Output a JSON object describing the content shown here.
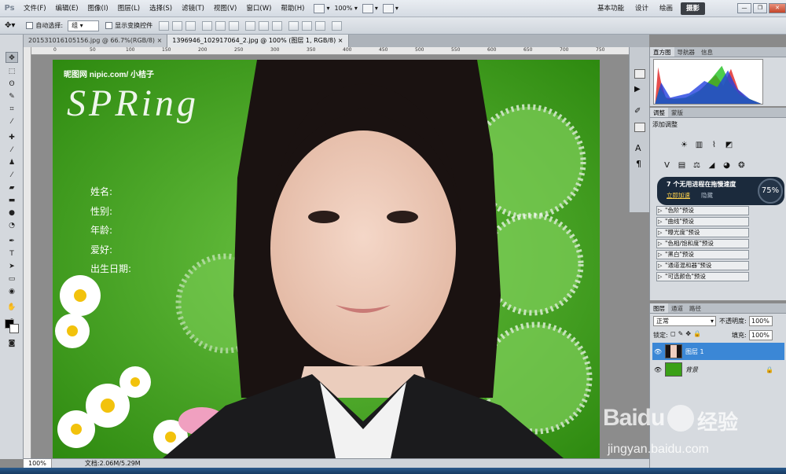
{
  "app": {
    "logo": "Ps"
  },
  "menu": [
    "文件(F)",
    "编辑(E)",
    "图像(I)",
    "图层(L)",
    "选择(S)",
    "滤镜(T)",
    "视图(V)",
    "窗口(W)",
    "帮助(H)"
  ],
  "menubar_zoom": "100%",
  "workspaces": [
    {
      "label": "基本功能",
      "active": false
    },
    {
      "label": "设计",
      "active": false
    },
    {
      "label": "绘画",
      "active": false
    },
    {
      "label": "摄影",
      "active": true
    }
  ],
  "window_buttons": {
    "minimize": "—",
    "restore": "❐",
    "close": "✕"
  },
  "options": {
    "auto_select_label": "自动选择:",
    "auto_select_value": "组",
    "transform_label": "显示变换控件"
  },
  "tabs": [
    {
      "label": "201531016105156.jpg @ 66.7%(RGB/8)",
      "close": "×",
      "active": false
    },
    {
      "label": "1396946_102917064_2.jpg @ 100% (图层 1, RGB/8)",
      "close": "×",
      "active": true
    }
  ],
  "ruler_ticks": [
    "0",
    "50",
    "100",
    "150",
    "200",
    "250",
    "300",
    "350",
    "400",
    "450",
    "500",
    "550",
    "600",
    "650",
    "700",
    "750"
  ],
  "poster": {
    "watermark": "昵图网 nipic.com/ 小桔子",
    "spring": "SPRing",
    "fields": [
      "姓名:",
      "性别:",
      "年龄:",
      "爱好:",
      "出生日期:"
    ]
  },
  "status": {
    "zoom": "100%",
    "doc": "文档:2.06M/5.29M"
  },
  "histogram": {
    "tabs": [
      "直方图",
      "导航器",
      "信息"
    ]
  },
  "adjust": {
    "tabs": [
      "调整",
      "蒙版"
    ],
    "title": "添加调整",
    "presets": [
      "\"色阶\"预设",
      "\"曲线\"预设",
      "\"曝光度\"预设",
      "\"色相/饱和度\"预设",
      "\"黑白\"预设",
      "\"通道混和器\"预设",
      "\"可选颜色\"预设"
    ]
  },
  "progress": {
    "text": "7 个无用进程在拖慢速度",
    "link1": "立即加速",
    "link2": "隐藏",
    "percent": "75%"
  },
  "layers": {
    "tabs": [
      "图层",
      "通道",
      "路径"
    ],
    "blend": "正常",
    "opacity_label": "不透明度:",
    "opacity": "100%",
    "lock_label": "锁定:",
    "fill_label": "填充:",
    "fill": "100%",
    "items": [
      {
        "name": "图层 1",
        "selected": true
      },
      {
        "name": "背景",
        "selected": false
      }
    ]
  },
  "baidu": {
    "logo": "Baidu",
    "brand": "经验",
    "url": "jingyan.baidu.com"
  }
}
